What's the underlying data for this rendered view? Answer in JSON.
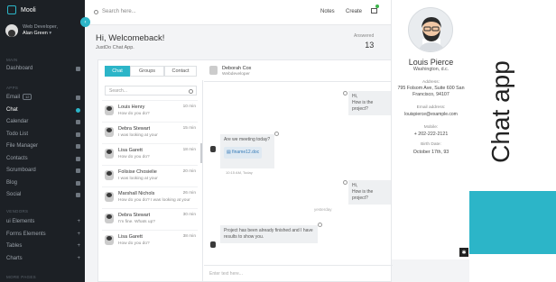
{
  "app": {
    "name": "Mooli",
    "accent": "#2cb5c8",
    "sidebar_bg": "#1c2025"
  },
  "user": {
    "role": "Web Developer,",
    "name": "Alan Green"
  },
  "sidebar": {
    "sections": [
      {
        "label": "MAIN"
      },
      {
        "label": "APPS"
      },
      {
        "label": "VENDORS"
      },
      {
        "label": "MORE PAGES"
      }
    ],
    "items": [
      {
        "label": "Dashboard",
        "icon": "dashboard-icon"
      },
      {
        "label": "Email",
        "badge": "12",
        "icon": "envelope-icon"
      },
      {
        "label": "Chat",
        "icon": "chat-icon",
        "active": true
      },
      {
        "label": "Calendar",
        "icon": "calendar-icon"
      },
      {
        "label": "Todo List",
        "icon": "list-icon"
      },
      {
        "label": "File Manager",
        "icon": "folder-icon"
      },
      {
        "label": "Contacts",
        "icon": "contacts-icon"
      },
      {
        "label": "Scrumboard",
        "icon": "board-icon"
      },
      {
        "label": "Blog",
        "icon": "blog-icon"
      },
      {
        "label": "Social",
        "icon": "social-icon"
      },
      {
        "label": "ui Elements",
        "icon": "plus-icon"
      },
      {
        "label": "Forms Elements",
        "icon": "plus-icon"
      },
      {
        "label": "Tables",
        "icon": "plus-icon"
      },
      {
        "label": "Charts",
        "icon": "plus-icon"
      }
    ]
  },
  "header": {
    "search_placeholder": "Search here...",
    "links": [
      "Notes",
      "Create"
    ]
  },
  "welcome": {
    "title": "Hi, Welcomeback!",
    "subtitle": "JustDo Chat App."
  },
  "stats": {
    "answered_label": "Answered",
    "answered_value": "13"
  },
  "chat": {
    "tabs": [
      "Chat",
      "Groups",
      "Contact"
    ],
    "search_placeholder": "Search...",
    "contacts": [
      {
        "name": "Louis Henry",
        "preview": "How do you do?",
        "time": "10 min"
      },
      {
        "name": "Debra Stewart",
        "preview": "I was looking at your",
        "time": "15 min"
      },
      {
        "name": "Lisa Garett",
        "preview": "How do you do?",
        "time": "18 min"
      },
      {
        "name": "Folisise Chosielie",
        "preview": "I was looking at your",
        "time": "20 min"
      },
      {
        "name": "Marshall Nichols",
        "preview": "How do you do? I was looking at your",
        "time": "26 min"
      },
      {
        "name": "Debra Stewart",
        "preview": "I'm fine. Whats up?",
        "time": "30 min"
      },
      {
        "name": "Lisa Garett",
        "preview": "How do you do?",
        "time": "38 min"
      }
    ],
    "active_name": "Deborah Cox",
    "active_role": "Webdeveloper",
    "messages": {
      "right_1": "Hi,\nHow is the project?",
      "left_1": "Are we meeting today?",
      "file_name": "finame12.doc",
      "left_1_time": "10:15 AM, Today",
      "right_2": "Hi,\nHow is the project?",
      "divider": "yesterday",
      "left_2": "Project has been already finished and I have results to show you."
    },
    "composer_placeholder": "Enter text here..."
  },
  "profile": {
    "name": "Louis Pierce",
    "location": "Washington, d.c.",
    "address_label": "Address:",
    "address": "795 Folsom Ave, Suite 600 San Francisco, 94107",
    "email_label": "Email address:",
    "email": "louispierce@example.com",
    "mobile_label": "Mobile:",
    "mobile": "+ 202-222-2121",
    "birth_label": "Birth Date:",
    "birth": "October 17th, 93"
  },
  "brand": {
    "title": "Chat app"
  }
}
